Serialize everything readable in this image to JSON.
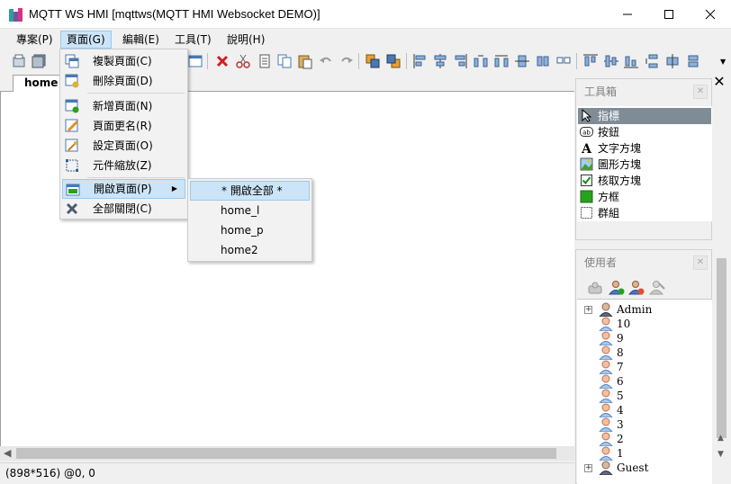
{
  "window": {
    "title": "MQTT WS HMI [mqttws(MQTT HMI Websocket DEMO)]"
  },
  "menubar": {
    "items": [
      "專案(P)",
      "頁面(G)",
      "編輯(E)",
      "工具(T)",
      "說明(H)"
    ]
  },
  "tabs": [
    "home"
  ],
  "page_menu": {
    "items": [
      {
        "label": "複製頁面(C)",
        "icon": "copy-page-icon"
      },
      {
        "label": "刪除頁面(D)",
        "icon": "delete-page-icon"
      },
      {
        "label": "新增頁面(N)",
        "icon": "new-page-icon"
      },
      {
        "label": "頁面更名(R)",
        "icon": "rename-page-icon"
      },
      {
        "label": "設定頁面(O)",
        "icon": "page-settings-icon"
      },
      {
        "label": "元件縮放(Z)",
        "icon": "scale-icon"
      },
      {
        "label": "開啟頁面(P)",
        "icon": "open-page-icon"
      },
      {
        "label": "全部關閉(C)",
        "icon": "close-all-icon"
      }
    ]
  },
  "open_page_submenu": {
    "items": [
      "* 開啟全部 *",
      "home_l",
      "home_p",
      "home2"
    ]
  },
  "toolbox": {
    "title": "工具箱",
    "items": [
      {
        "label": "指標",
        "icon": "pointer-icon"
      },
      {
        "label": "按鈕",
        "icon": "button-icon"
      },
      {
        "label": "文字方塊",
        "icon": "text-icon"
      },
      {
        "label": "圖形方塊",
        "icon": "picture-icon"
      },
      {
        "label": "核取方塊",
        "icon": "checkbox-icon"
      },
      {
        "label": "方框",
        "icon": "frame-icon"
      },
      {
        "label": "群組",
        "icon": "group-icon"
      }
    ]
  },
  "users": {
    "title": "使用者",
    "tree": [
      {
        "label": "Admin",
        "group": true
      },
      {
        "label": "10"
      },
      {
        "label": "9"
      },
      {
        "label": "8"
      },
      {
        "label": "7"
      },
      {
        "label": "6"
      },
      {
        "label": "5"
      },
      {
        "label": "4"
      },
      {
        "label": "3"
      },
      {
        "label": "2"
      },
      {
        "label": "1"
      },
      {
        "label": "Guest",
        "group": true
      }
    ]
  },
  "status": {
    "text": "(898*516) @0, 0"
  },
  "colors": {
    "menu_highlight": "#cce4f7",
    "menu_highlight_border": "#99c9ef",
    "selected_tool": "#7f8c96"
  }
}
